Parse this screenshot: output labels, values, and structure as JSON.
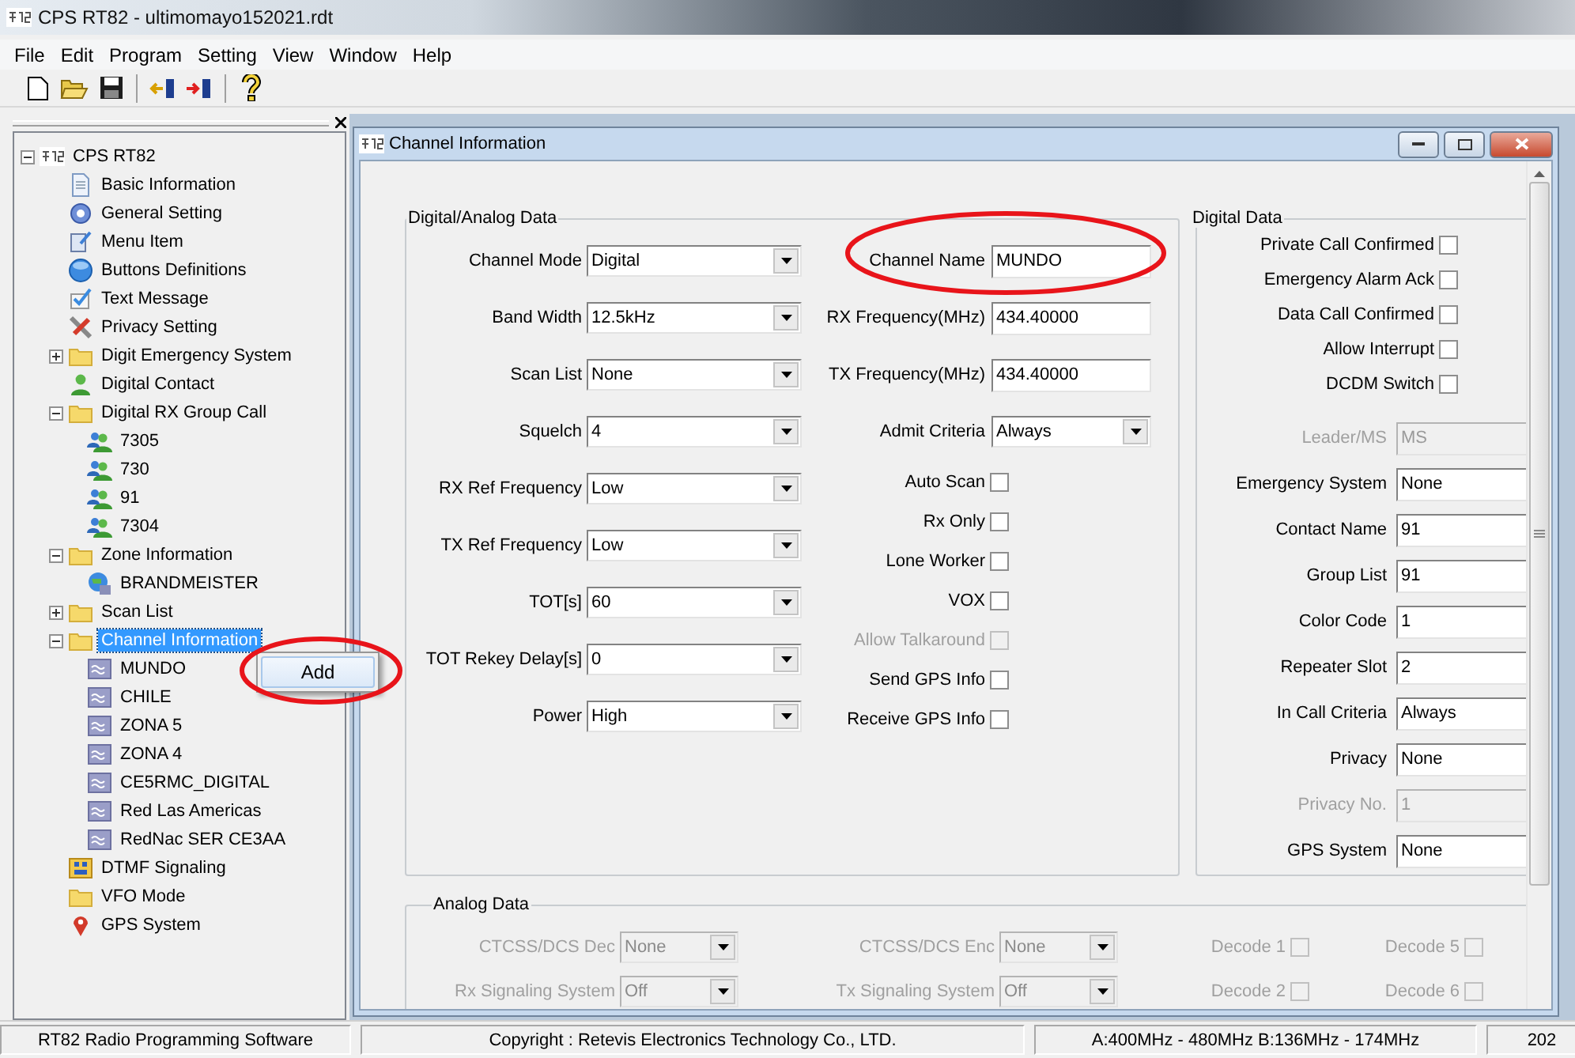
{
  "window": {
    "title": "CPS RT82 - ultimomayo152021.rdt"
  },
  "menu": [
    {
      "label": "File"
    },
    {
      "label": "Edit"
    },
    {
      "label": "Program"
    },
    {
      "label": "Setting"
    },
    {
      "label": "View"
    },
    {
      "label": "Window"
    },
    {
      "label": "Help"
    }
  ],
  "tree": {
    "label": "CPS RT82",
    "kind": "root",
    "expanded": true,
    "selected": false,
    "children": [
      {
        "label": "Basic Information",
        "kind": "document",
        "selected": false
      },
      {
        "label": "General Setting",
        "kind": "gear",
        "selected": false
      },
      {
        "label": "Menu Item",
        "kind": "menu",
        "selected": false
      },
      {
        "label": "Buttons Definitions",
        "kind": "button",
        "selected": false
      },
      {
        "label": "Text Message",
        "kind": "message",
        "selected": false
      },
      {
        "label": "Privacy Setting",
        "kind": "privacy",
        "selected": false
      },
      {
        "label": "Digit Emergency System",
        "kind": "folder",
        "expanded": false,
        "selected": false
      },
      {
        "label": "Digital Contact",
        "kind": "contact",
        "selected": false
      },
      {
        "label": "Digital RX Group Call",
        "kind": "folder",
        "expanded": true,
        "selected": false,
        "children": [
          {
            "label": "7305",
            "kind": "group",
            "selected": false
          },
          {
            "label": "730",
            "kind": "group",
            "selected": false
          },
          {
            "label": "91",
            "kind": "group",
            "selected": false
          },
          {
            "label": "7304",
            "kind": "group",
            "selected": false
          }
        ]
      },
      {
        "label": "Zone Information",
        "kind": "folder",
        "expanded": true,
        "selected": false,
        "children": [
          {
            "label": "BRANDMEISTER",
            "kind": "zone",
            "selected": false
          }
        ]
      },
      {
        "label": "Scan List",
        "kind": "folder",
        "expanded": false,
        "selected": false
      },
      {
        "label": "Channel Information",
        "kind": "folder",
        "expanded": true,
        "selected": true,
        "children": [
          {
            "label": "MUNDO",
            "kind": "channel",
            "selected": false
          },
          {
            "label": "CHILE",
            "kind": "channel",
            "selected": false
          },
          {
            "label": "ZONA 5",
            "kind": "channel",
            "selected": false
          },
          {
            "label": "ZONA 4",
            "kind": "channel",
            "selected": false
          },
          {
            "label": "CE5RMC_DIGITAL",
            "kind": "channel",
            "selected": false
          },
          {
            "label": "Red Las Americas",
            "kind": "channel",
            "selected": false
          },
          {
            "label": "RedNac SER CE3AA",
            "kind": "channel",
            "selected": false
          }
        ]
      },
      {
        "label": "DTMF Signaling",
        "kind": "dtmf",
        "selected": false
      },
      {
        "label": "VFO Mode",
        "kind": "folder",
        "selected": false
      },
      {
        "label": "GPS System",
        "kind": "gps",
        "selected": false
      }
    ]
  },
  "context_menu": {
    "items": [
      {
        "label": "Add",
        "highlighted": true
      }
    ]
  },
  "channel_window": {
    "title": "Channel Information",
    "digital_analog": {
      "title": "Digital/Analog Data",
      "settings": [
        {
          "label": "Channel Mode",
          "kind": "select",
          "value": "Digital",
          "disabled": false
        },
        {
          "label": "Band Width",
          "kind": "select",
          "value": "12.5kHz",
          "disabled": false
        },
        {
          "label": "Scan List",
          "kind": "select",
          "value": "None",
          "disabled": false
        },
        {
          "label": "Squelch",
          "kind": "select",
          "value": "4",
          "disabled": false
        },
        {
          "label": "RX Ref Frequency",
          "kind": "select",
          "value": "Low",
          "disabled": false
        },
        {
          "label": "TX Ref Frequency",
          "kind": "select",
          "value": "Low",
          "disabled": false
        },
        {
          "label": "TOT[s]",
          "kind": "select",
          "value": "60",
          "disabled": false
        },
        {
          "label": "TOT Rekey Delay[s]",
          "kind": "select",
          "value": "0",
          "disabled": false
        },
        {
          "label": "Power",
          "kind": "select",
          "value": "High",
          "disabled": false
        }
      ],
      "channel": [
        {
          "label": "Channel Name",
          "kind": "input",
          "value": "MUNDO",
          "disabled": false
        },
        {
          "label": "RX Frequency(MHz)",
          "kind": "input",
          "value": "434.40000",
          "disabled": false
        },
        {
          "label": "TX Frequency(MHz)",
          "kind": "input",
          "value": "434.40000",
          "disabled": false
        },
        {
          "label": "Admit Criteria",
          "kind": "select",
          "value": "Always",
          "disabled": false
        },
        {
          "label": "Auto Scan",
          "kind": "checkbox",
          "checked": false,
          "disabled": false
        },
        {
          "label": "Rx Only",
          "kind": "checkbox",
          "checked": false,
          "disabled": false
        },
        {
          "label": "Lone Worker",
          "kind": "checkbox",
          "checked": false,
          "disabled": false
        },
        {
          "label": "VOX",
          "kind": "checkbox",
          "checked": false,
          "disabled": false
        },
        {
          "label": "Allow Talkaround",
          "kind": "checkbox",
          "checked": false,
          "disabled": true
        },
        {
          "label": "Send GPS Info",
          "kind": "checkbox",
          "checked": false,
          "disabled": false
        },
        {
          "label": "Receive GPS Info",
          "kind": "checkbox",
          "checked": false,
          "disabled": false
        }
      ]
    },
    "digital": {
      "title": "Digital Data",
      "checks": [
        {
          "label": "Private Call Confirmed",
          "kind": "checkbox",
          "checked": false,
          "disabled": false
        },
        {
          "label": "Emergency Alarm Ack",
          "kind": "checkbox",
          "checked": false,
          "disabled": false
        },
        {
          "label": "Data Call Confirmed",
          "kind": "checkbox",
          "checked": false,
          "disabled": false
        },
        {
          "label": "Allow Interrupt",
          "kind": "checkbox",
          "checked": false,
          "disabled": false
        },
        {
          "label": "DCDM Switch",
          "kind": "checkbox",
          "checked": false,
          "disabled": false
        }
      ],
      "fields": [
        {
          "label": "Leader/MS",
          "kind": "input",
          "value": "MS",
          "disabled": true
        },
        {
          "label": "Emergency System",
          "kind": "input",
          "value": "None",
          "disabled": false
        },
        {
          "label": "Contact Name",
          "kind": "input",
          "value": "91",
          "disabled": false
        },
        {
          "label": "Group List",
          "kind": "input",
          "value": "91",
          "disabled": false
        },
        {
          "label": "Color Code",
          "kind": "input",
          "value": "1",
          "disabled": false
        },
        {
          "label": "Repeater Slot",
          "kind": "input",
          "value": "2",
          "disabled": false
        },
        {
          "label": "In Call Criteria",
          "kind": "input",
          "value": "Always",
          "disabled": false
        },
        {
          "label": "Privacy",
          "kind": "input",
          "value": "None",
          "disabled": false
        },
        {
          "label": "Privacy No.",
          "kind": "input",
          "value": "1",
          "disabled": true
        },
        {
          "label": "GPS System",
          "kind": "input",
          "value": "None",
          "disabled": false
        }
      ]
    },
    "analog": {
      "title": "Analog Data",
      "items": [
        {
          "label": "CTCSS/DCS Dec",
          "kind": "select",
          "value": "None",
          "disabled": true
        },
        {
          "label": "CTCSS/DCS Enc",
          "kind": "select",
          "value": "None",
          "disabled": true
        },
        {
          "label": "Decode 1",
          "kind": "checkbox",
          "checked": false,
          "disabled": true
        },
        {
          "label": "Decode 5",
          "kind": "checkbox",
          "checked": false,
          "disabled": true
        },
        {
          "label": "Rx Signaling System",
          "kind": "select",
          "value": "Off",
          "disabled": true
        },
        {
          "label": "Tx Signaling System",
          "kind": "select",
          "value": "Off",
          "disabled": true
        },
        {
          "label": "Decode 2",
          "kind": "checkbox",
          "checked": false,
          "disabled": true
        },
        {
          "label": "Decode 6",
          "kind": "checkbox",
          "checked": false,
          "disabled": true
        }
      ]
    }
  },
  "status_bar": [
    {
      "text": "RT82 Radio Programming Software"
    },
    {
      "text": "Copyright : Retevis Electronics Technology Co., LTD."
    },
    {
      "text": "A:400MHz - 480MHz B:136MHz - 174MHz"
    },
    {
      "text": "202"
    }
  ]
}
